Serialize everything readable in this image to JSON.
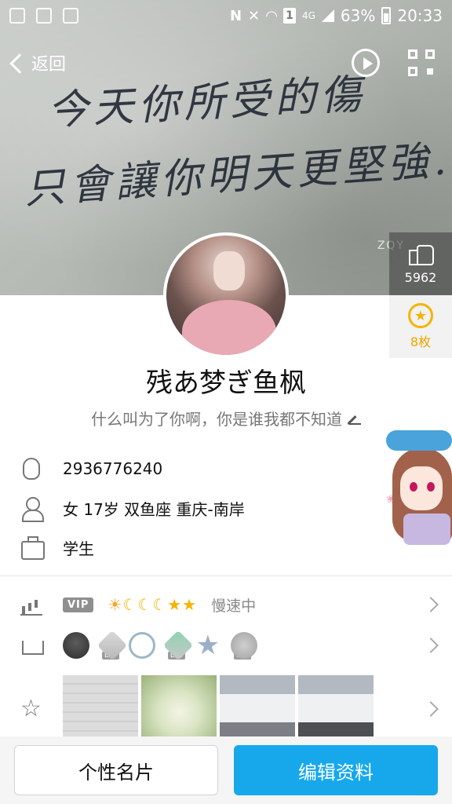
{
  "status_bar": {
    "battery": "63%",
    "time": "20:33",
    "network": "4G",
    "sim": "1"
  },
  "nav": {
    "back_label": "返回"
  },
  "cover": {
    "line1": "今天你所受的傷",
    "line2": "只會讓你明天更堅強.",
    "watermark": "ZQY"
  },
  "side": {
    "likes": "5962",
    "medals": "8枚"
  },
  "profile": {
    "nickname": "残あ梦ぎ鱼枫",
    "signature": "什么叫为了你啊，你是谁我都不知道"
  },
  "info": {
    "qq": "2936776240",
    "details": "女  17岁  双鱼座  重庆-南岸",
    "occupation": "学生"
  },
  "vip": {
    "badge": "VIP",
    "speed": "慢速中"
  },
  "badges": {
    "lv1": "LV4",
    "lv2": "LV2",
    "lv3": "LV1"
  },
  "buttons": {
    "card": "个性名片",
    "edit": "编辑资料"
  },
  "colors": {
    "accent": "#17a8ec",
    "medal": "#f5b400"
  }
}
